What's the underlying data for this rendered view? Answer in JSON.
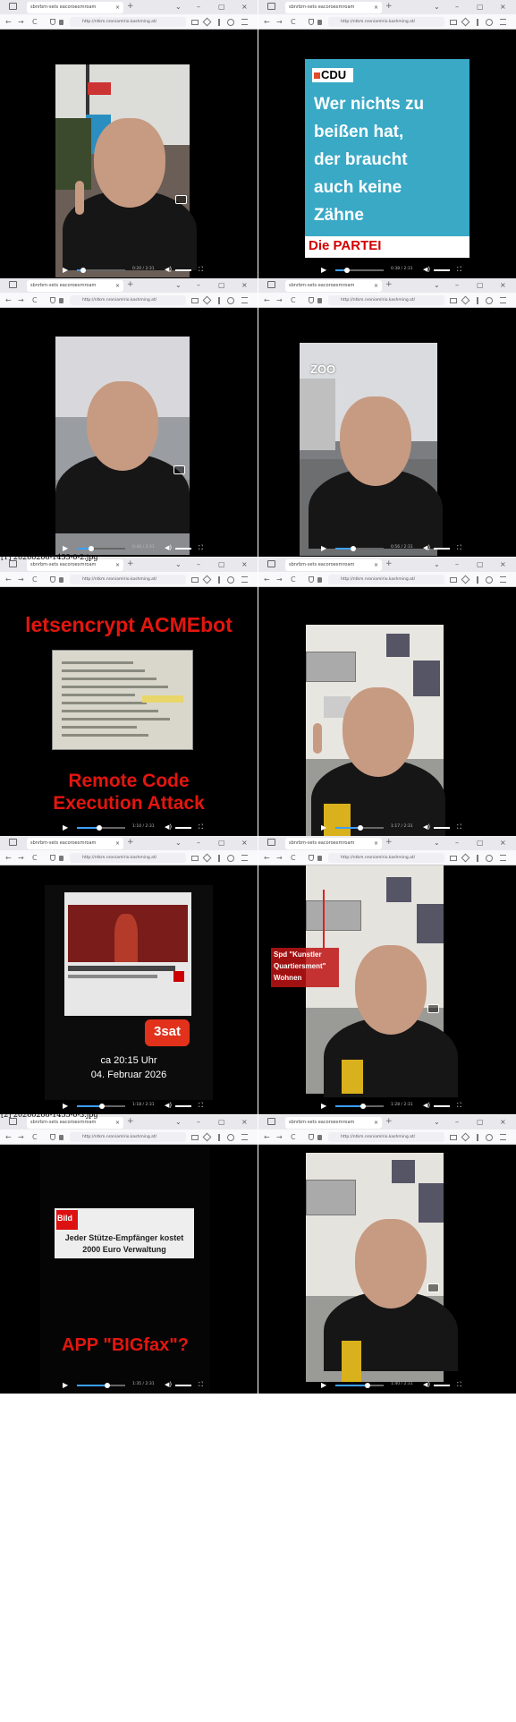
{
  "captions": [
    "[1] 20260206-1455-0-2.jpg",
    "[2] 20260206-1455-0-3.jpg"
  ],
  "browser": {
    "tab_title": "sbnrbm-sets eacoroexmroam",
    "tab_close": "×",
    "new_tab": "+",
    "url": "http://ntkm.nroniamlrio.kashming.at/",
    "btn_back": "←",
    "btn_forward": "→",
    "btn_reload": "C",
    "btn_minimize": "–",
    "btn_maximize": "▢",
    "btn_close": "×",
    "btn_tablist": "⌄"
  },
  "player": {
    "play": "▶",
    "volume": "◀)",
    "fullscreen": "⛶"
  },
  "frames": [
    {
      "time": "0:20 / 2:31",
      "progress": 0.13
    },
    {
      "time": "0:38 / 2:31",
      "progress": 0.24,
      "poster_brand": "CDU",
      "poster_text": [
        "Wer nichts zu",
        "beißen hat,",
        "der braucht",
        "auch keine",
        "Zähne"
      ],
      "poster_footer": "Die PARTEI"
    },
    {
      "time": "0:46 / 2:31",
      "progress": 0.3
    },
    {
      "time": "0:56 / 2:31",
      "progress": 0.37,
      "sign": "ZOO"
    },
    {
      "time": "1:10 / 2:31",
      "progress": 0.46,
      "title": "letsencrypt ACMEbot",
      "bottom_text": [
        "Remote Code",
        "Execution Attack"
      ]
    },
    {
      "time": "1:17 / 2:31",
      "progress": 0.51
    },
    {
      "time": "1:18 / 2:31",
      "progress": 0.52,
      "badge": "3sat",
      "when": [
        "ca 20:15 Uhr",
        "04. Februar 2026"
      ]
    },
    {
      "time": "1:28 / 2:31",
      "progress": 0.58,
      "label": [
        "Spd \"Kunstler",
        "Quartiersment\"",
        "Wohnen"
      ]
    },
    {
      "time": "1:35 / 2:31",
      "progress": 0.63,
      "headline": [
        "Jeder Stütze-Empfänger kostet",
        "2000 Euro Verwaltung"
      ],
      "brand": "Bild",
      "title": "APP \"BIGfax\"?"
    },
    {
      "time": "1:40 / 2:31",
      "progress": 0.66
    }
  ]
}
